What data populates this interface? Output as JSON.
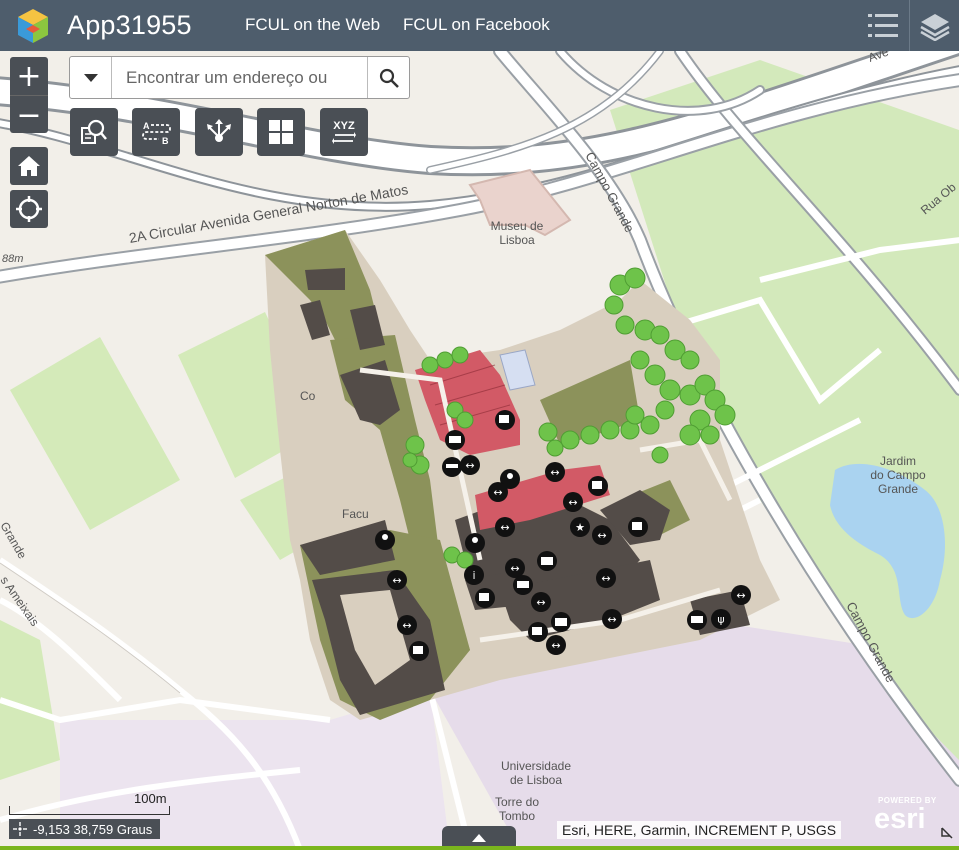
{
  "header": {
    "app_title": "App31955",
    "links": [
      "FCUL on the Web",
      "FCUL on Facebook"
    ],
    "buttons": {
      "list_icon": "list-icon",
      "layers_icon": "layers-icon"
    }
  },
  "zoom": {
    "in_label": "+",
    "out_label": "−"
  },
  "nav_buttons": [
    "home-icon",
    "locate-icon"
  ],
  "search": {
    "placeholder": "Encontrar um endereço ou"
  },
  "toolbar": [
    {
      "icon": "query-icon"
    },
    {
      "icon": "directions-icon"
    },
    {
      "icon": "share-icon"
    },
    {
      "icon": "grid-icon"
    },
    {
      "label": "XYZ",
      "icon": "coordinate-convert-icon"
    }
  ],
  "map": {
    "labels": {
      "museu_1": "Museu de",
      "museu_2": "Lisboa",
      "avenida": "2A Circular Avenida General Norton de Matos",
      "campo_grande_1": "Campo Grande",
      "campo_grande_2": "Campo Grande",
      "jardim_1": "Jardim",
      "jardim_2": "do Campo",
      "jardim_3": "Grande",
      "universidade_1": "Universidade",
      "universidade_2": "de Lisboa",
      "torre_1": "Torre do",
      "torre_2": "Tombo",
      "ameixais": "s Ameixais",
      "grande_left": "Grande",
      "rua_ob": "Rua Ob",
      "av_top": "Ave",
      "co": "Co",
      "facu": "Facu",
      "m88": "88m"
    },
    "colors": {
      "land": "#f2efe9",
      "road": "#ffffff",
      "road_casing": "#b5b5b5",
      "highway": "#9aa0a6",
      "green": "#cfe7b2",
      "park": "#d8ecc0",
      "water": "#a9d3f0",
      "campus": "#d9cfbf",
      "olive": "#8c925b",
      "building": "#534c48",
      "red": "#d65b66",
      "tree": "#6fc24b",
      "purple": "#e5dcea"
    }
  },
  "scale": {
    "label": "100m"
  },
  "coordinates": {
    "text": "-9,153 38,759 Graus"
  },
  "attribution": "Esri, HERE, Garmin, INCREMENT P, USGS",
  "esri_logo": {
    "powered": "POWERED BY",
    "name": "esri"
  }
}
